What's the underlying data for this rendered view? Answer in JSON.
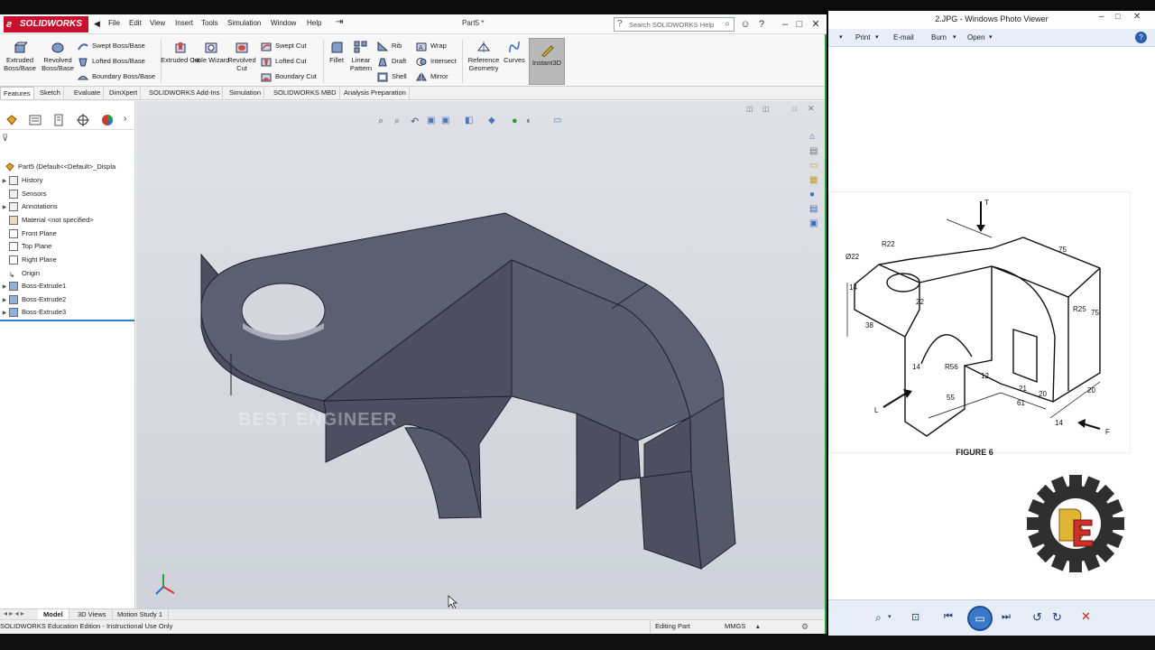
{
  "solidworks": {
    "brand": "SOLIDWORKS",
    "menu": [
      "File",
      "Edit",
      "View",
      "Insert",
      "Tools",
      "Simulation",
      "Window",
      "Help"
    ],
    "doc_title": "Part5 *",
    "search_placeholder": "Search SOLIDWORKS Help",
    "ribbon": {
      "extruded_boss": "Extruded Boss/Base",
      "revolved_boss": "Revolved Boss/Base",
      "swept_boss": "Swept Boss/Base",
      "lofted_boss": "Lofted Boss/Base",
      "boundary_boss": "Boundary Boss/Base",
      "extruded_cut": "Extruded Cut",
      "hole_wizard": "Hole Wizard",
      "revolved_cut": "Revolved Cut",
      "swept_cut": "Swept Cut",
      "lofted_cut": "Lofted Cut",
      "boundary_cut": "Boundary Cut",
      "fillet": "Fillet",
      "linear_pattern": "Linear Pattern",
      "rib": "Rib",
      "draft": "Draft",
      "shell": "Shell",
      "wrap": "Wrap",
      "intersect": "Intersect",
      "mirror": "Mirror",
      "reference_geometry": "Reference Geometry",
      "curves": "Curves",
      "instant3d": "Instant3D"
    },
    "tabs": [
      "Features",
      "Sketch",
      "Evaluate",
      "DimXpert",
      "SOLIDWORKS Add-Ins",
      "Simulation",
      "SOLIDWORKS MBD",
      "Analysis Preparation"
    ],
    "tree": [
      {
        "label": "Part5  (Default<<Default>_Displa",
        "expand": false
      },
      {
        "label": "History",
        "expand": true
      },
      {
        "label": "Sensors",
        "expand": false
      },
      {
        "label": "Annotations",
        "expand": true
      },
      {
        "label": "Material <not specified>",
        "expand": false
      },
      {
        "label": "Front Plane",
        "expand": false
      },
      {
        "label": "Top Plane",
        "expand": false
      },
      {
        "label": "Right Plane",
        "expand": false
      },
      {
        "label": "Origin",
        "expand": false
      },
      {
        "label": "Boss-Extrude1",
        "expand": true
      },
      {
        "label": "Boss-Extrude2",
        "expand": true
      },
      {
        "label": "Boss-Extrude3",
        "expand": true
      }
    ],
    "watermark": "BEST ENGINEER",
    "bottom_tabs": [
      "Model",
      "3D Views",
      "Motion Study 1"
    ],
    "status_left": "SOLIDWORKS Education Edition - Instructional Use Only",
    "status_mode": "Editing Part",
    "status_units": "MMGS"
  },
  "photo_viewer": {
    "title": "2.JPG - Windows Photo Viewer",
    "menu": [
      "Print",
      "E-mail",
      "Burn",
      "Open"
    ],
    "figure_caption": "FIGURE 6",
    "drawing_labels": [
      "T",
      "R22",
      "Ø22",
      "75",
      "14",
      "R25",
      "75",
      "38",
      "22",
      "R56",
      "14",
      "12",
      "55",
      "21",
      "20",
      "61",
      "20",
      "14",
      "L",
      "F"
    ]
  },
  "colors": {
    "sw_accent": "#c8102e",
    "part_face": "#5c5e72",
    "part_face_dark": "#4d4f61",
    "viewport_bg": "#d9dbe2",
    "selection": "#2a7fd4"
  }
}
